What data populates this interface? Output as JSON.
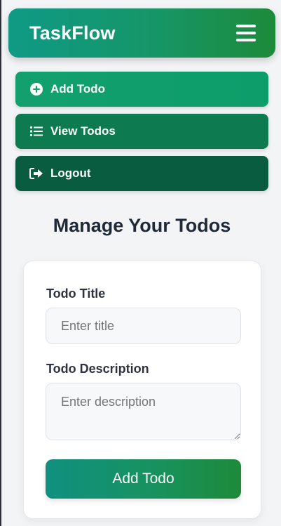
{
  "header": {
    "brand": "TaskFlow",
    "menu_icon": "hamburger-icon"
  },
  "menu": {
    "items": [
      {
        "label": "Add Todo",
        "icon": "plus-circle-icon"
      },
      {
        "label": "View Todos",
        "icon": "list-icon"
      },
      {
        "label": "Logout",
        "icon": "logout-icon"
      }
    ]
  },
  "main": {
    "title": "Manage Your Todos"
  },
  "form": {
    "title_label": "Todo Title",
    "title_placeholder": "Enter title",
    "title_value": "",
    "description_label": "Todo Description",
    "description_placeholder": "Enter description",
    "description_value": "",
    "submit_label": "Add Todo"
  },
  "colors": {
    "accent_start": "#0f9a86",
    "accent_end": "#1e8a3a",
    "add_item": "#13a06e",
    "view_item": "#0d7a50",
    "logout_item": "#0a5c40",
    "heading": "#1f2937"
  }
}
